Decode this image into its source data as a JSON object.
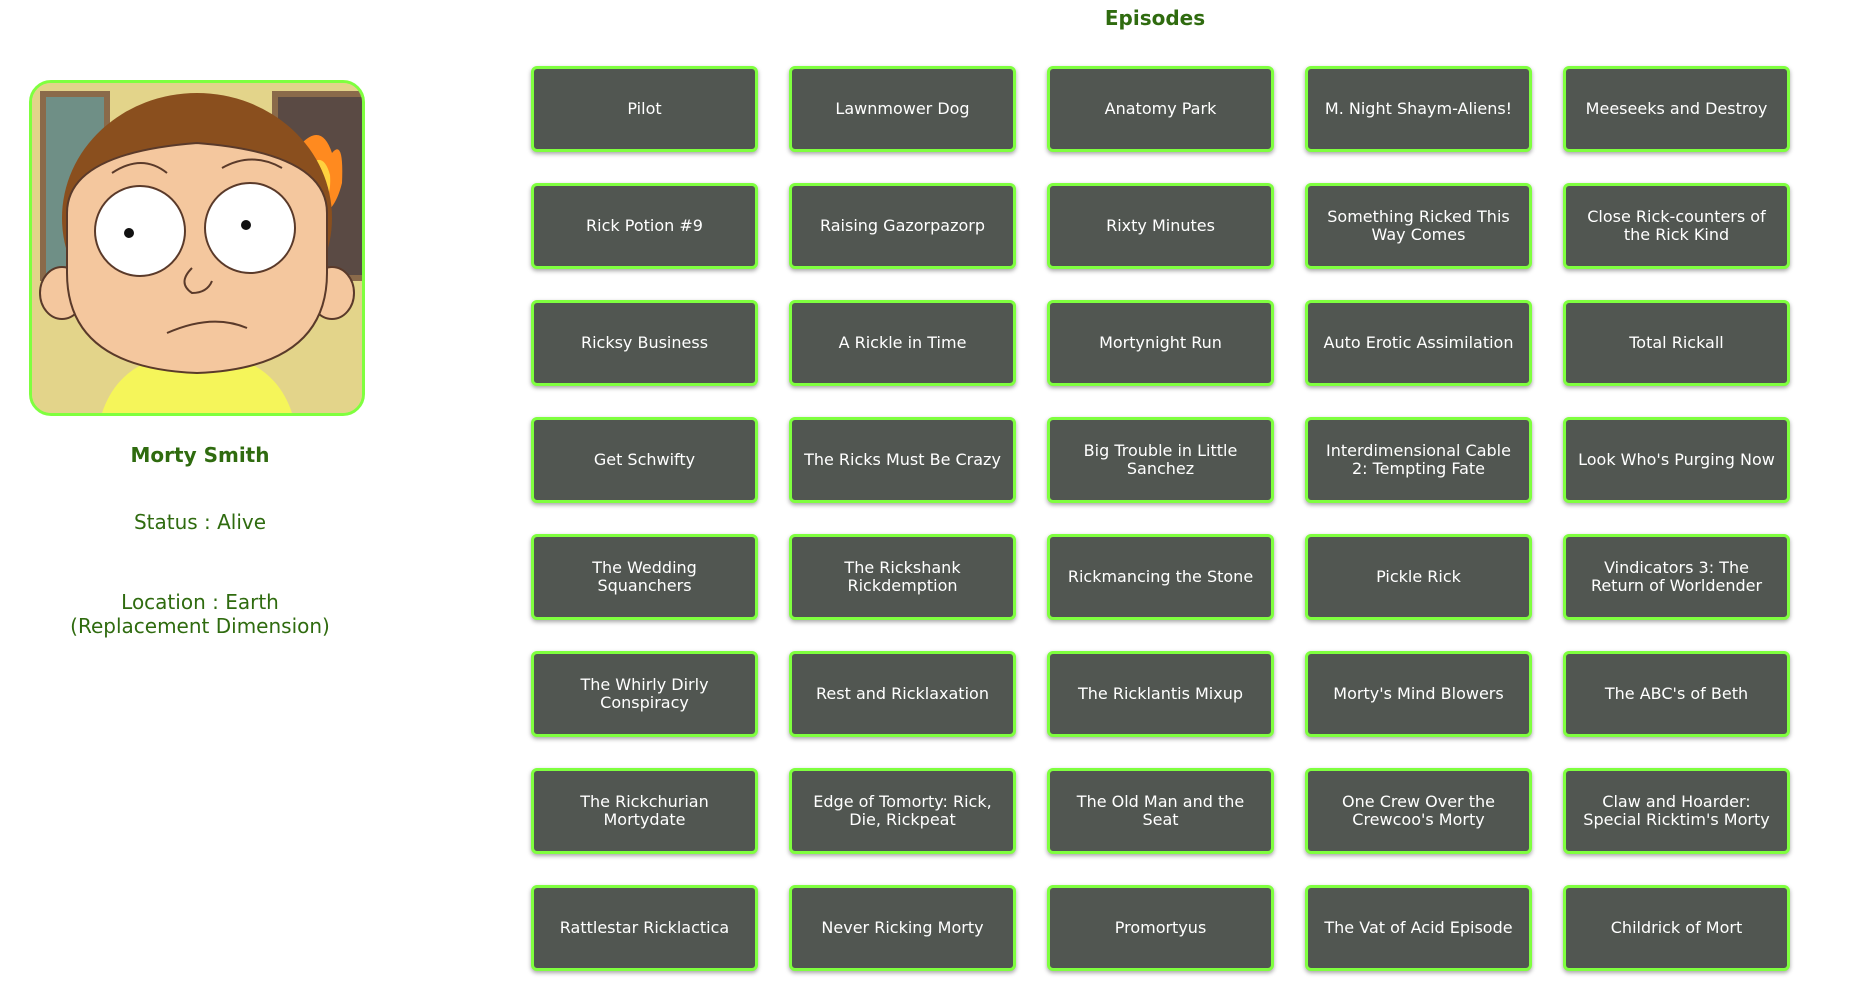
{
  "character": {
    "name": "Morty Smith",
    "status": "Status : Alive",
    "location": "Location : Earth (Replacement Dimension)"
  },
  "episodes": {
    "title": "Episodes",
    "items": [
      "Pilot",
      "Lawnmower Dog",
      "Anatomy Park",
      "M. Night Shaym-Aliens!",
      "Meeseeks and Destroy",
      "Rick Potion #9",
      "Raising Gazorpazorp",
      "Rixty Minutes",
      "Something Ricked This Way Comes",
      "Close Rick-counters of the Rick Kind",
      "Ricksy Business",
      "A Rickle in Time",
      "Mortynight Run",
      "Auto Erotic Assimilation",
      "Total Rickall",
      "Get Schwifty",
      "The Ricks Must Be Crazy",
      "Big Trouble in Little Sanchez",
      "Interdimensional Cable 2: Tempting Fate",
      "Look Who's Purging Now",
      "The Wedding Squanchers",
      "The Rickshank Rickdemption",
      "Rickmancing the Stone",
      "Pickle Rick",
      "Vindicators 3: The Return of Worldender",
      "The Whirly Dirly Conspiracy",
      "Rest and Ricklaxation",
      "The Ricklantis Mixup",
      "Morty's Mind Blowers",
      "The ABC's of Beth",
      "The Rickchurian Mortydate",
      "Edge of Tomorty: Rick, Die, Rickpeat",
      "The Old Man and the Seat",
      "One Crew Over the Crewcoo's Morty",
      "Claw and Hoarder: Special Ricktim's Morty",
      "Rattlestar Ricklactica",
      "Never Ricking Morty",
      "Promortyus",
      "The Vat of Acid Episode",
      "Childrick of Mort"
    ]
  }
}
